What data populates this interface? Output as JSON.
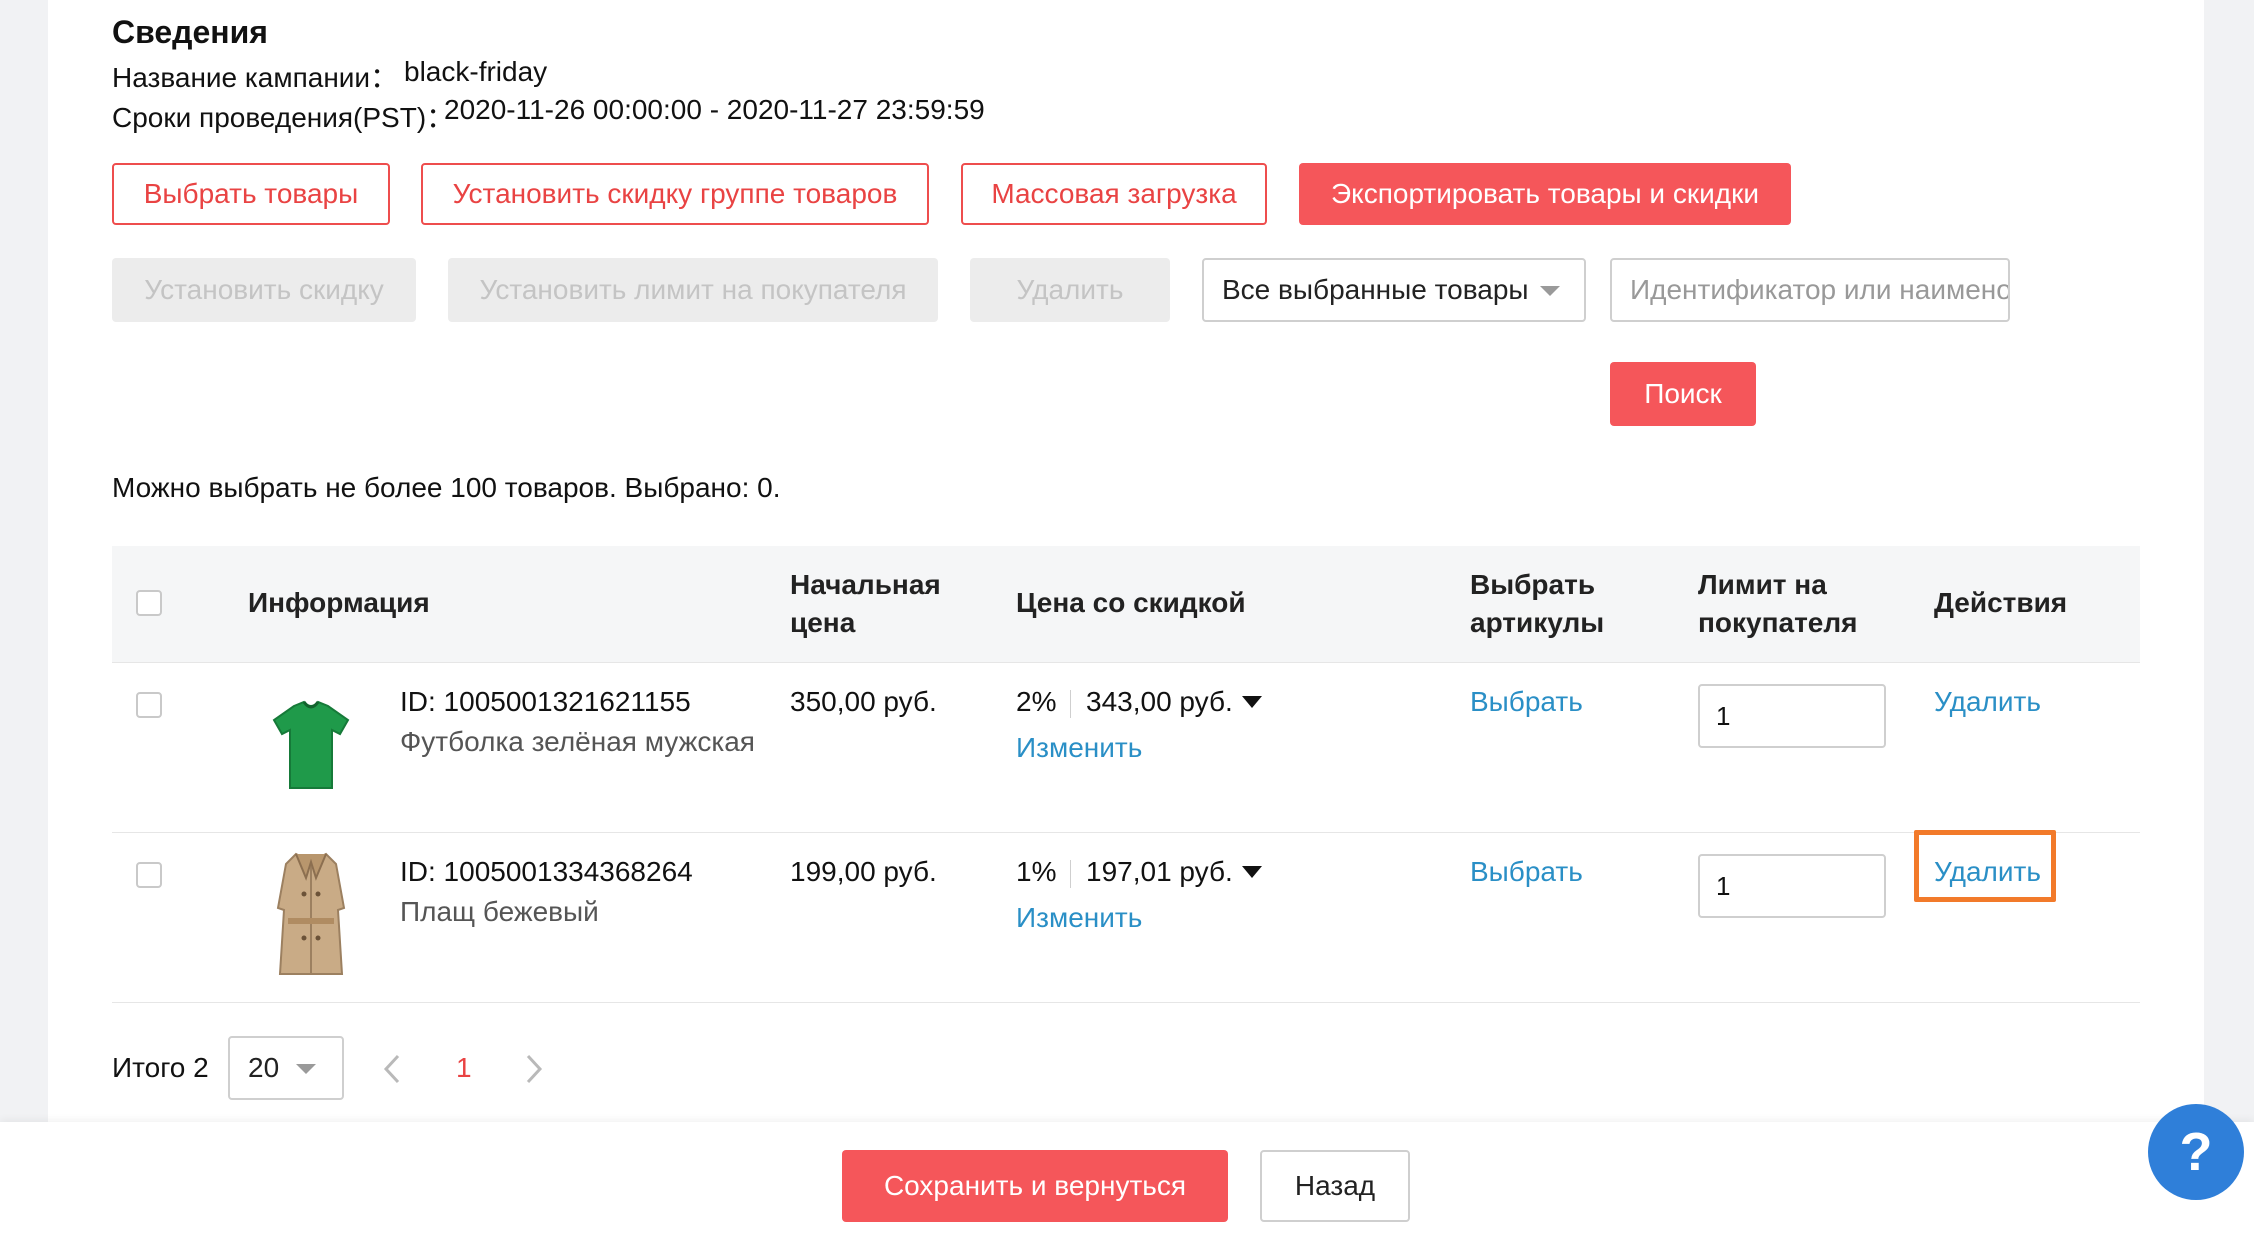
{
  "details": {
    "title": "Сведения",
    "campaign_name_label": "Название кампании：",
    "campaign_name_value": "black-friday",
    "period_label": "Сроки проведения(PST)：",
    "period_value": "2020-11-26 00:00:00 - 2020-11-27 23:59:59"
  },
  "actions": {
    "select_products": "Выбрать товары",
    "group_discount": "Установить скидку группе товаров",
    "bulk_upload": "Массовая загрузка",
    "export": "Экспортировать товары и скидки"
  },
  "filters": {
    "set_discount": "Установить скидку",
    "set_buyer_limit": "Установить лимит на покупателя",
    "delete": "Удалить",
    "scope_select_value": "Все выбранные товары",
    "search_placeholder": "Идентификатор или наименование",
    "search_button": "Поиск"
  },
  "selection_note": "Можно выбрать не более 100 товаров. Выбрано: 0.",
  "table": {
    "columns": {
      "info": "Информация",
      "start_price_l1": "Начальная",
      "start_price_l2": "цена",
      "discount_price": "Цена со скидкой",
      "choose_sku_l1": "Выбрать",
      "choose_sku_l2": "артикулы",
      "limit_l1": "Лимит на",
      "limit_l2": "покупателя",
      "actions": "Действия"
    },
    "rows": [
      {
        "id": "ID: 1005001321621155",
        "name": "Футболка зелёная мужская",
        "start_price": "350,00 руб.",
        "discount_percent": "2%",
        "discount_price": "343,00 руб.",
        "edit": "Изменить",
        "choose": "Выбрать",
        "limit": "1",
        "delete": "Удалить"
      },
      {
        "id": "ID: 1005001334368264",
        "name": "Плащ бежевый",
        "start_price": "199,00 руб.",
        "discount_percent": "1%",
        "discount_price": "197,01 руб.",
        "edit": "Изменить",
        "choose": "Выбрать",
        "limit": "1",
        "delete": "Удалить"
      }
    ]
  },
  "pagination": {
    "total": "Итого 2",
    "page_size": "20",
    "current_page": "1"
  },
  "footer": {
    "save_return": "Сохранить и вернуться",
    "back": "Назад"
  },
  "help": "?",
  "colors": {
    "accent": "#f5565a",
    "link": "#2a8fc6",
    "highlight": "#f27a2a",
    "help": "#2f7fd9"
  }
}
